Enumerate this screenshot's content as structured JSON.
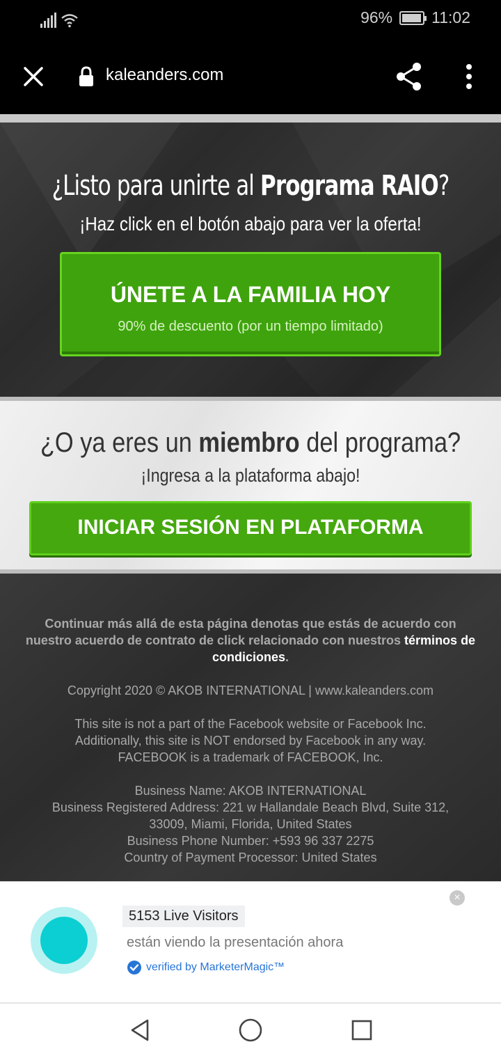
{
  "status_bar": {
    "battery": "96%",
    "time": "11:02",
    "battery_level": 0.96
  },
  "browser": {
    "url": "kaleanders.com"
  },
  "offer": {
    "title_pre": "¿Listo para unirte al ",
    "title_bold": "Programa RAIO",
    "title_post": "?",
    "subtitle": "¡Haz click en el botón abajo para ver la oferta!",
    "button_main": "ÚNETE A LA FAMILIA HOY",
    "button_sub": "90% de descuento (por un tiempo limitado)"
  },
  "member": {
    "title_pre": "¿O ya eres un ",
    "title_bold": "miembro",
    "title_post": " del programa?",
    "subtitle": "¡Ingresa a la plataforma abajo!",
    "button": "INICIAR SESIÓN EN PLATAFORMA"
  },
  "footer": {
    "terms_text": "Continuar más allá de esta página denotas que estás de acuerdo con nuestro acuerdo de contrato de click relacionado con nuestros ",
    "terms_link": "términos de condiciones",
    "terms_end": ".",
    "copyright": "Copyright 2020 © AKOB INTERNATIONAL | www.kaleanders.com",
    "fb_line1": "This site is not a part of the Facebook website or Facebook Inc.",
    "fb_line2": "Additionally, this site is NOT endorsed by Facebook in any way.",
    "fb_line3": "FACEBOOK is a trademark of FACEBOOK, Inc.",
    "biz_line1": "Business Name: AKOB INTERNATIONAL",
    "biz_line2": "Business Registered Address: 221 w Hallandale Beach Blvd, Suite 312,",
    "biz_line3": "33009, Miami, Florida, United States",
    "biz_line4": "Business Phone Number: +593 96 337 2275",
    "biz_line5": "Country of Payment Processor: United States"
  },
  "popup": {
    "visitors": "5153 Live Visitors",
    "viewing": "están viendo la presentación ahora",
    "verified": "verified by MarketerMagic™",
    "close": "×"
  },
  "colors": {
    "accent_green": "#45a80e",
    "pulse_teal": "#0bcfd2",
    "verified_blue": "#2775d6"
  }
}
